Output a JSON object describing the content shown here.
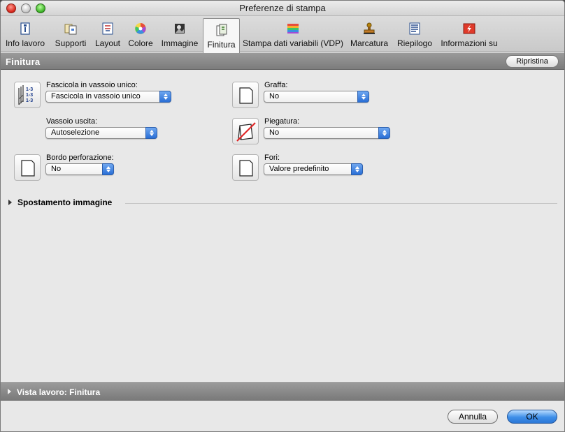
{
  "window": {
    "title": "Preferenze di stampa"
  },
  "toolbar": {
    "tabs": [
      {
        "label": "Info lavoro",
        "icon": "info-icon"
      },
      {
        "label": "Supporti",
        "icon": "media-icon"
      },
      {
        "label": "Layout",
        "icon": "layout-icon"
      },
      {
        "label": "Colore",
        "icon": "color-wheel-icon"
      },
      {
        "label": "Immagine",
        "icon": "image-icon"
      },
      {
        "label": "Finitura",
        "icon": "finishing-icon",
        "active": true
      },
      {
        "label": "Stampa dati variabili (VDP)",
        "icon": "vdp-icon"
      },
      {
        "label": "Marcatura",
        "icon": "stamp-icon"
      },
      {
        "label": "Riepilogo",
        "icon": "summary-icon"
      },
      {
        "label": "Informazioni su",
        "icon": "about-icon"
      }
    ]
  },
  "section": {
    "title": "Finitura",
    "reset_label": "Ripristina"
  },
  "fields": {
    "collate": {
      "label": "Fascicola in vassoio unico:",
      "value": "Fascicola in vassoio unico"
    },
    "output_tray": {
      "label": "Vassoio uscita:",
      "value": "Autoselezione"
    },
    "punch_edge": {
      "label": "Bordo perforazione:",
      "value": "No"
    },
    "staple": {
      "label": "Graffa:",
      "value": "No"
    },
    "fold": {
      "label": "Piegatura:",
      "value": "No"
    },
    "holes": {
      "label": "Fori:",
      "value": "Valore predefinito"
    }
  },
  "image_shift": {
    "label": "Spostamento immagine"
  },
  "preview": {
    "label": "Vista lavoro: Finitura"
  },
  "footer": {
    "cancel_label": "Annulla",
    "ok_label": "OK"
  },
  "colors": {
    "accent": "#3d8ee8",
    "header_bg": "#8a8a8a",
    "window_bg": "#e8e8e8"
  }
}
